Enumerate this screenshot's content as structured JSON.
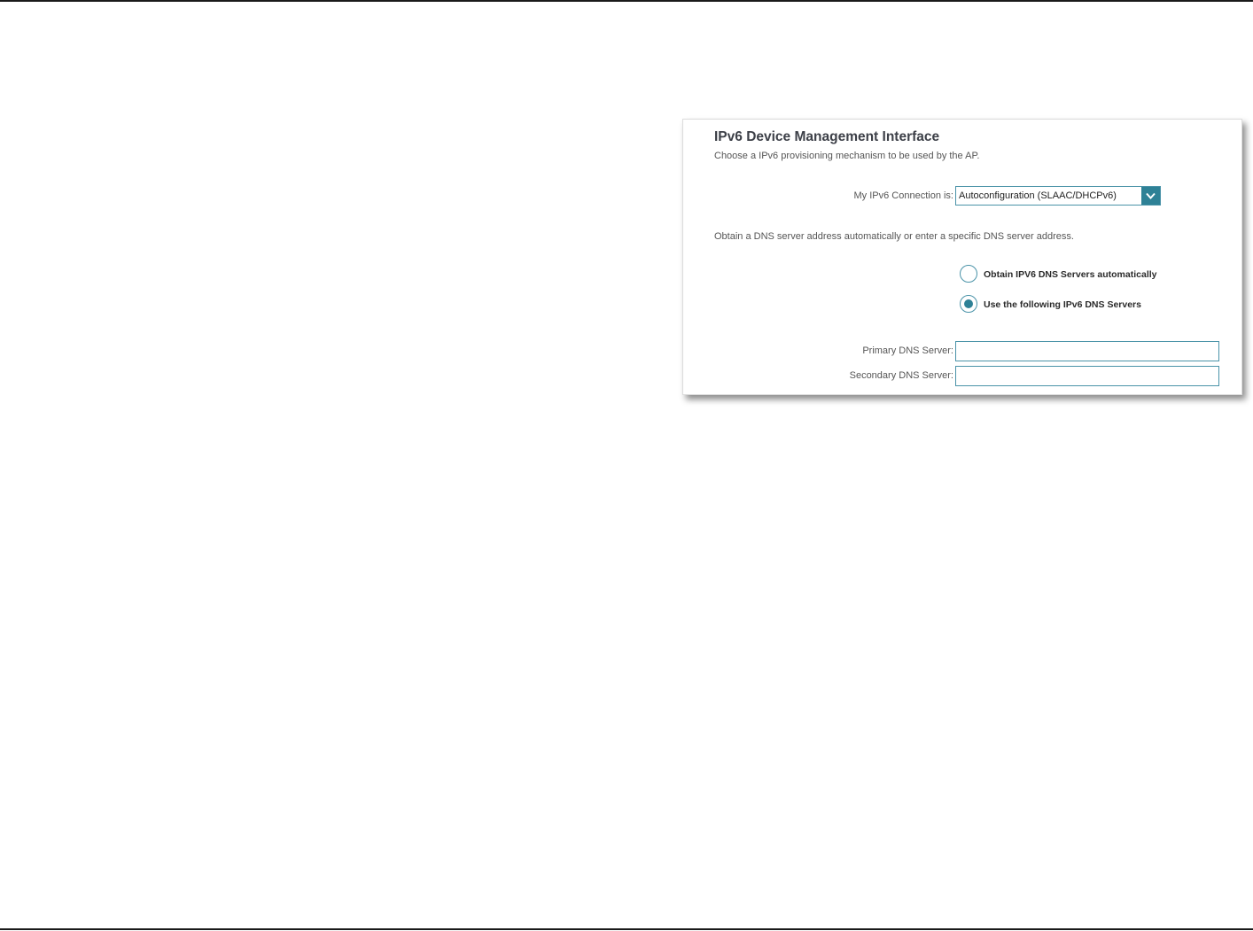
{
  "panel": {
    "title": "IPv6 Device Management Interface",
    "description": "Choose a IPv6 provisioning mechanism to be used by the AP.",
    "connection": {
      "label": "My IPv6 Connection is:",
      "selected": "Autoconfiguration (SLAAC/DHCPv6)",
      "icon": "chevron-down-icon"
    },
    "dns_description": "Obtain a DNS server address automatically or enter a specific DNS server address.",
    "dns_options": [
      {
        "label": "Obtain IPV6 DNS Servers automatically",
        "selected": false
      },
      {
        "label": "Use the following IPv6 DNS Servers",
        "selected": true
      }
    ],
    "primary_dns": {
      "label": "Primary DNS Server:",
      "value": ""
    },
    "secondary_dns": {
      "label": "Secondary DNS Server:",
      "value": ""
    }
  },
  "colors": {
    "accent": "#2e8196",
    "border": "#4a93a8",
    "title": "#3d4048",
    "text": "#555555"
  }
}
